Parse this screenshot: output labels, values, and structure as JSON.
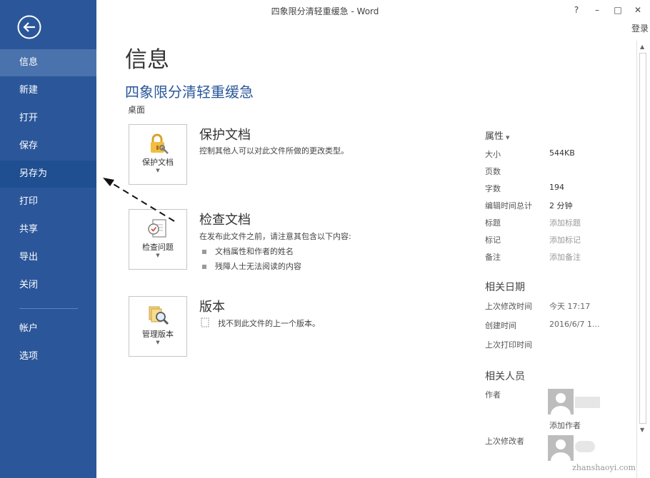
{
  "window": {
    "title": "四象限分清轻重缓急 - Word",
    "help": "?",
    "minimize": "–",
    "maximize": "□",
    "close": "✕",
    "login": "登录"
  },
  "sidebar": {
    "items": [
      {
        "label": "信息"
      },
      {
        "label": "新建"
      },
      {
        "label": "打开"
      },
      {
        "label": "保存"
      },
      {
        "label": "另存为"
      },
      {
        "label": "打印"
      },
      {
        "label": "共享"
      },
      {
        "label": "导出"
      },
      {
        "label": "关闭"
      },
      {
        "label": "帐户"
      },
      {
        "label": "选项"
      }
    ],
    "active_item": "信息",
    "hover_item": "另存为"
  },
  "main": {
    "page_title": "信息",
    "doc_name": "四象限分清轻重缓急",
    "doc_location": "桌面",
    "protect": {
      "button": "保护文档",
      "title": "保护文档",
      "desc": "控制其他人可以对此文件所做的更改类型。"
    },
    "inspect": {
      "button": "检查问题",
      "title": "检查文档",
      "desc": "在发布此文件之前，请注意其包含以下内容:",
      "bullets": [
        "文档属性和作者的姓名",
        "残障人士无法阅读的内容"
      ]
    },
    "versions": {
      "button": "管理版本",
      "title": "版本",
      "desc": "找不到此文件的上一个版本。"
    }
  },
  "properties": {
    "head": "属性",
    "rows": [
      {
        "label": "大小",
        "value": "544KB"
      },
      {
        "label": "页数",
        "value": ""
      },
      {
        "label": "字数",
        "value": "194"
      },
      {
        "label": "编辑时间总计",
        "value": "2 分钟"
      },
      {
        "label": "标题",
        "value": "添加标题"
      },
      {
        "label": "标记",
        "value": "添加标记"
      },
      {
        "label": "备注",
        "value": "添加备注"
      }
    ],
    "dates_head": "相关日期",
    "dates": [
      {
        "label": "上次修改时间",
        "value": "今天 17:17"
      },
      {
        "label": "创建时间",
        "value": "2016/6/7 1..."
      },
      {
        "label": "上次打印时间",
        "value": ""
      }
    ],
    "people_head": "相关人员",
    "author_label": "作者",
    "add_author": "添加作者",
    "last_modified_by": "上次修改者"
  },
  "watermark": "zhanshaoyi.com",
  "colors": {
    "sidebar": "#2b579a",
    "accent": "#2b579a"
  }
}
